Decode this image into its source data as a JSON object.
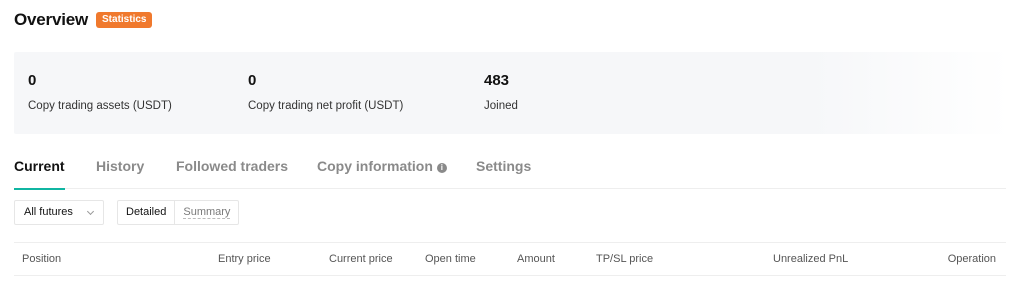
{
  "header": {
    "title": "Overview",
    "badge": "Statistics"
  },
  "stats": [
    {
      "value": "0",
      "label": "Copy trading assets (USDT)"
    },
    {
      "value": "0",
      "label": "Copy trading net profit (USDT)"
    },
    {
      "value": "483",
      "label": "Joined"
    }
  ],
  "tabs": [
    {
      "label": "Current",
      "active": true
    },
    {
      "label": "History"
    },
    {
      "label": "Followed traders"
    },
    {
      "label": "Copy information"
    },
    {
      "label": "Settings"
    }
  ],
  "filter": {
    "label": "All futures"
  },
  "view_toggle": {
    "detailed": "Detailed",
    "summary": "Summary",
    "selected": "Detailed"
  },
  "table": {
    "columns": [
      "Position",
      "Entry price",
      "Current price",
      "Open time",
      "Amount",
      "TP/SL price",
      "Unrealized PnL",
      "Operation"
    ]
  },
  "colors": {
    "accent": "#10b5a2",
    "badge": "#f0792d"
  }
}
